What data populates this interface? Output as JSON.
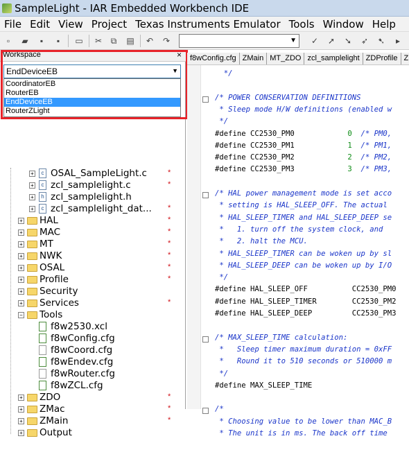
{
  "window": {
    "title": "SampleLight - IAR Embedded Workbench IDE"
  },
  "menu": [
    "File",
    "Edit",
    "View",
    "Project",
    "Texas Instruments Emulator",
    "Tools",
    "Window",
    "Help"
  ],
  "workspace": {
    "header": "Workspace",
    "close": "×",
    "selected_config": "EndDeviceEB",
    "options": [
      "CoordinatorEB",
      "RouterEB",
      "EndDeviceEB",
      "RouterZLight"
    ],
    "selected_index": 2
  },
  "tree": [
    {
      "label": "OSAL_SampleLight.c",
      "kind": "file-c",
      "depth": 2,
      "mark": "*"
    },
    {
      "label": "zcl_samplelight.c",
      "kind": "file-c",
      "depth": 2,
      "mark": "*"
    },
    {
      "label": "zcl_samplelight.h",
      "kind": "file-h",
      "depth": 2,
      "mark": ""
    },
    {
      "label": "zcl_samplelight_dat...",
      "kind": "file-c",
      "depth": 2,
      "mark": "*"
    },
    {
      "label": "HAL",
      "kind": "folder",
      "depth": 1,
      "mark": "*"
    },
    {
      "label": "MAC",
      "kind": "folder",
      "depth": 1,
      "mark": "*"
    },
    {
      "label": "MT",
      "kind": "folder",
      "depth": 1,
      "mark": "*"
    },
    {
      "label": "NWK",
      "kind": "folder",
      "depth": 1,
      "mark": "*"
    },
    {
      "label": "OSAL",
      "kind": "folder",
      "depth": 1,
      "mark": "*"
    },
    {
      "label": "Profile",
      "kind": "folder",
      "depth": 1,
      "mark": "*"
    },
    {
      "label": "Security",
      "kind": "folder",
      "depth": 1,
      "mark": ""
    },
    {
      "label": "Services",
      "kind": "folder",
      "depth": 1,
      "mark": "*"
    },
    {
      "label": "Tools",
      "kind": "folder-open",
      "depth": 1,
      "mark": ""
    },
    {
      "label": "f8w2530.xcl",
      "kind": "file-green",
      "depth": 2,
      "mark": ""
    },
    {
      "label": "f8wConfig.cfg",
      "kind": "file-green",
      "depth": 2,
      "mark": ""
    },
    {
      "label": "f8wCoord.cfg",
      "kind": "file-grey",
      "depth": 2,
      "mark": ""
    },
    {
      "label": "f8wEndev.cfg",
      "kind": "file-green",
      "depth": 2,
      "mark": ""
    },
    {
      "label": "f8wRouter.cfg",
      "kind": "file-grey",
      "depth": 2,
      "mark": ""
    },
    {
      "label": "f8wZCL.cfg",
      "kind": "file-green",
      "depth": 2,
      "mark": ""
    },
    {
      "label": "ZDO",
      "kind": "folder",
      "depth": 1,
      "mark": "*"
    },
    {
      "label": "ZMac",
      "kind": "folder",
      "depth": 1,
      "mark": "*"
    },
    {
      "label": "ZMain",
      "kind": "folder",
      "depth": 1,
      "mark": "*"
    },
    {
      "label": "Output",
      "kind": "folder",
      "depth": 1,
      "mark": ""
    }
  ],
  "tabs": [
    "f8wConfig.cfg",
    "ZMain",
    "MT_ZDO",
    "zcl_samplelight",
    "ZDProfile",
    "ZD"
  ],
  "code": [
    {
      "text": "  */",
      "type": "comment"
    },
    {
      "text": "",
      "type": "plain"
    },
    {
      "text": "/* POWER CONSERVATION DEFINITIONS",
      "type": "comment",
      "fold": true
    },
    {
      "text": " * Sleep mode H/W definitions (enabled w",
      "type": "comment"
    },
    {
      "text": " */",
      "type": "comment"
    },
    {
      "text": "#define CC2530_PM0            0  /* PM0,",
      "type": "define"
    },
    {
      "text": "#define CC2530_PM1            1  /* PM1,",
      "type": "define"
    },
    {
      "text": "#define CC2530_PM2            2  /* PM2,",
      "type": "define"
    },
    {
      "text": "#define CC2530_PM3            3  /* PM3,",
      "type": "define"
    },
    {
      "text": "",
      "type": "plain"
    },
    {
      "text": "/* HAL power management mode is set acco",
      "type": "comment",
      "fold": true
    },
    {
      "text": " * setting is HAL_SLEEP_OFF. The actual",
      "type": "comment"
    },
    {
      "text": " * HAL_SLEEP_TIMER and HAL_SLEEP_DEEP se",
      "type": "comment"
    },
    {
      "text": " *   1. turn off the system clock, and",
      "type": "comment"
    },
    {
      "text": " *   2. halt the MCU.",
      "type": "comment"
    },
    {
      "text": " * HAL_SLEEP_TIMER can be woken up by sl",
      "type": "comment"
    },
    {
      "text": " * HAL_SLEEP_DEEP can be woken up by I/O",
      "type": "comment"
    },
    {
      "text": " */",
      "type": "comment"
    },
    {
      "text": "#define HAL_SLEEP_OFF          CC2530_PM0",
      "type": "plain"
    },
    {
      "text": "#define HAL_SLEEP_TIMER        CC2530_PM2",
      "type": "plain"
    },
    {
      "text": "#define HAL_SLEEP_DEEP         CC2530_PM3",
      "type": "plain"
    },
    {
      "text": "",
      "type": "plain"
    },
    {
      "text": "/* MAX_SLEEP_TIME calculation:",
      "type": "comment",
      "fold": true
    },
    {
      "text": " *   Sleep timer maximum duration = 0xFF",
      "type": "comment"
    },
    {
      "text": " *   Round it to 510 seconds or 510000 m",
      "type": "comment"
    },
    {
      "text": " */",
      "type": "comment"
    },
    {
      "text": "#define MAX_SLEEP_TIME",
      "type": "plain"
    },
    {
      "text": "",
      "type": "plain"
    },
    {
      "text": "/*",
      "type": "comment",
      "fold": true
    },
    {
      "text": " * Choosing value to be lower than MAC_B",
      "type": "comment"
    },
    {
      "text": " * The unit is in ms. The back off time",
      "type": "comment"
    }
  ]
}
